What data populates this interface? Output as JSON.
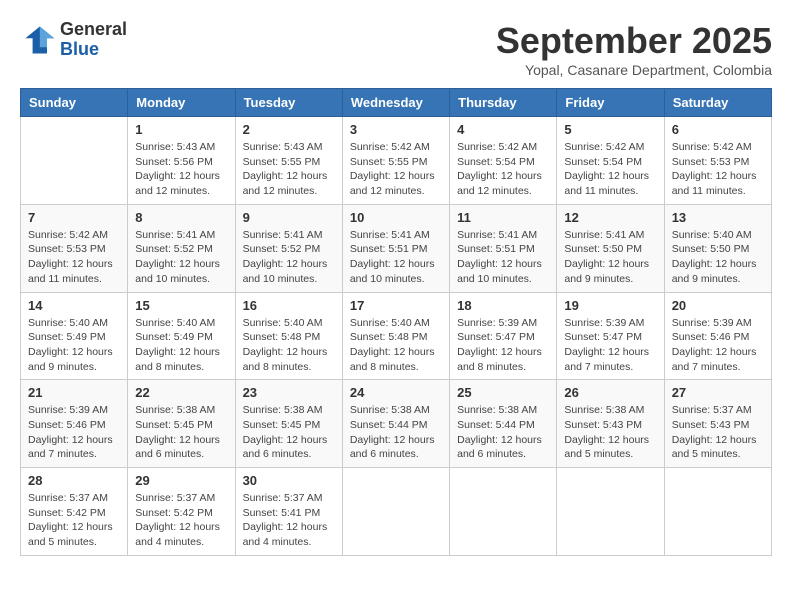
{
  "header": {
    "logo": {
      "line1": "General",
      "line2": "Blue"
    },
    "title": "September 2025",
    "subtitle": "Yopal, Casanare Department, Colombia"
  },
  "days_of_week": [
    "Sunday",
    "Monday",
    "Tuesday",
    "Wednesday",
    "Thursday",
    "Friday",
    "Saturday"
  ],
  "weeks": [
    [
      {
        "day": "",
        "info": ""
      },
      {
        "day": "1",
        "info": "Sunrise: 5:43 AM\nSunset: 5:56 PM\nDaylight: 12 hours\nand 12 minutes."
      },
      {
        "day": "2",
        "info": "Sunrise: 5:43 AM\nSunset: 5:55 PM\nDaylight: 12 hours\nand 12 minutes."
      },
      {
        "day": "3",
        "info": "Sunrise: 5:42 AM\nSunset: 5:55 PM\nDaylight: 12 hours\nand 12 minutes."
      },
      {
        "day": "4",
        "info": "Sunrise: 5:42 AM\nSunset: 5:54 PM\nDaylight: 12 hours\nand 12 minutes."
      },
      {
        "day": "5",
        "info": "Sunrise: 5:42 AM\nSunset: 5:54 PM\nDaylight: 12 hours\nand 11 minutes."
      },
      {
        "day": "6",
        "info": "Sunrise: 5:42 AM\nSunset: 5:53 PM\nDaylight: 12 hours\nand 11 minutes."
      }
    ],
    [
      {
        "day": "7",
        "info": "Sunrise: 5:42 AM\nSunset: 5:53 PM\nDaylight: 12 hours\nand 11 minutes."
      },
      {
        "day": "8",
        "info": "Sunrise: 5:41 AM\nSunset: 5:52 PM\nDaylight: 12 hours\nand 10 minutes."
      },
      {
        "day": "9",
        "info": "Sunrise: 5:41 AM\nSunset: 5:52 PM\nDaylight: 12 hours\nand 10 minutes."
      },
      {
        "day": "10",
        "info": "Sunrise: 5:41 AM\nSunset: 5:51 PM\nDaylight: 12 hours\nand 10 minutes."
      },
      {
        "day": "11",
        "info": "Sunrise: 5:41 AM\nSunset: 5:51 PM\nDaylight: 12 hours\nand 10 minutes."
      },
      {
        "day": "12",
        "info": "Sunrise: 5:41 AM\nSunset: 5:50 PM\nDaylight: 12 hours\nand 9 minutes."
      },
      {
        "day": "13",
        "info": "Sunrise: 5:40 AM\nSunset: 5:50 PM\nDaylight: 12 hours\nand 9 minutes."
      }
    ],
    [
      {
        "day": "14",
        "info": "Sunrise: 5:40 AM\nSunset: 5:49 PM\nDaylight: 12 hours\nand 9 minutes."
      },
      {
        "day": "15",
        "info": "Sunrise: 5:40 AM\nSunset: 5:49 PM\nDaylight: 12 hours\nand 8 minutes."
      },
      {
        "day": "16",
        "info": "Sunrise: 5:40 AM\nSunset: 5:48 PM\nDaylight: 12 hours\nand 8 minutes."
      },
      {
        "day": "17",
        "info": "Sunrise: 5:40 AM\nSunset: 5:48 PM\nDaylight: 12 hours\nand 8 minutes."
      },
      {
        "day": "18",
        "info": "Sunrise: 5:39 AM\nSunset: 5:47 PM\nDaylight: 12 hours\nand 8 minutes."
      },
      {
        "day": "19",
        "info": "Sunrise: 5:39 AM\nSunset: 5:47 PM\nDaylight: 12 hours\nand 7 minutes."
      },
      {
        "day": "20",
        "info": "Sunrise: 5:39 AM\nSunset: 5:46 PM\nDaylight: 12 hours\nand 7 minutes."
      }
    ],
    [
      {
        "day": "21",
        "info": "Sunrise: 5:39 AM\nSunset: 5:46 PM\nDaylight: 12 hours\nand 7 minutes."
      },
      {
        "day": "22",
        "info": "Sunrise: 5:38 AM\nSunset: 5:45 PM\nDaylight: 12 hours\nand 6 minutes."
      },
      {
        "day": "23",
        "info": "Sunrise: 5:38 AM\nSunset: 5:45 PM\nDaylight: 12 hours\nand 6 minutes."
      },
      {
        "day": "24",
        "info": "Sunrise: 5:38 AM\nSunset: 5:44 PM\nDaylight: 12 hours\nand 6 minutes."
      },
      {
        "day": "25",
        "info": "Sunrise: 5:38 AM\nSunset: 5:44 PM\nDaylight: 12 hours\nand 6 minutes."
      },
      {
        "day": "26",
        "info": "Sunrise: 5:38 AM\nSunset: 5:43 PM\nDaylight: 12 hours\nand 5 minutes."
      },
      {
        "day": "27",
        "info": "Sunrise: 5:37 AM\nSunset: 5:43 PM\nDaylight: 12 hours\nand 5 minutes."
      }
    ],
    [
      {
        "day": "28",
        "info": "Sunrise: 5:37 AM\nSunset: 5:42 PM\nDaylight: 12 hours\nand 5 minutes."
      },
      {
        "day": "29",
        "info": "Sunrise: 5:37 AM\nSunset: 5:42 PM\nDaylight: 12 hours\nand 4 minutes."
      },
      {
        "day": "30",
        "info": "Sunrise: 5:37 AM\nSunset: 5:41 PM\nDaylight: 12 hours\nand 4 minutes."
      },
      {
        "day": "",
        "info": ""
      },
      {
        "day": "",
        "info": ""
      },
      {
        "day": "",
        "info": ""
      },
      {
        "day": "",
        "info": ""
      }
    ]
  ]
}
